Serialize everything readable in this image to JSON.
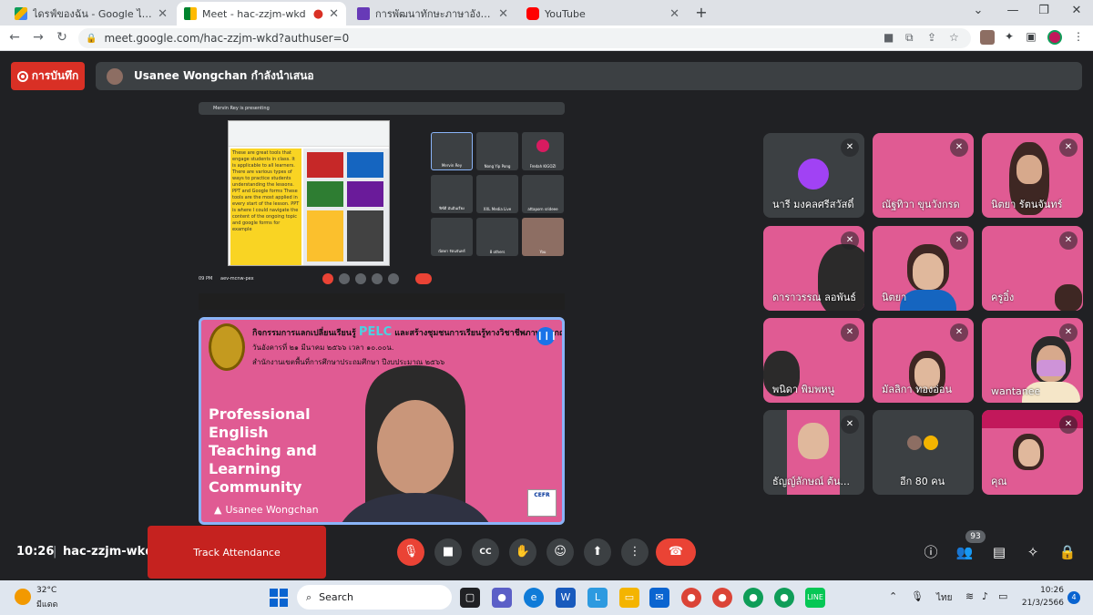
{
  "browser": {
    "tabs": [
      {
        "title": "ไดรฟ์ของฉัน - Google ไดรฟ์",
        "icon": "google-drive-icon",
        "active": false
      },
      {
        "title": "Meet - hac-zzjm-wkd",
        "icon": "google-meet-icon",
        "active": true
      },
      {
        "title": "การพัฒนาทักษะภาษาอังกฤษ English",
        "icon": "google-forms-icon",
        "active": false
      },
      {
        "title": "YouTube",
        "icon": "youtube-icon",
        "active": false
      }
    ],
    "url": "meet.google.com/hac-zzjm-wkd?authuser=0"
  },
  "meet": {
    "record_label": "การบันทึก",
    "presenting_text": "Usanee Wongchan กำลังนำเสนอ",
    "shared_screen": {
      "header": "Mervin Rey is presenting",
      "doc_text": "These are great tools that engage students in class. It is applicable to all learners. There are various types of ways to practice students understanding the lessons. PPT and Google forms These tools are the most applied in every start of the lesson. PPT is where I could navigate the content of the ongoing topic and google forms for example",
      "minis": [
        "Mervin Rey",
        "Nong Yip Pong",
        "Fredah KIGOZI",
        "ฟิซ์ดี มันอินเรียง",
        "XXL Media Live",
        "attaporn srideee",
        "ณิตยา รัตนจันทร์",
        "8 others",
        "You"
      ],
      "meeting_code": "aev-mcnw-pex",
      "time": "09 PM"
    },
    "speaker": {
      "slide_title_1": "กิจกรรมการแลกเปลี่ยนเรียนรู้",
      "slide_pelc": "PELC",
      "slide_title_1b": "และสร้างชุมชนการเรียนรู้ทางวิชาชีพภาษาอังกฤษ",
      "slide_title_2": "วันอังคารที่ ๒๑ มีนาคม ๒๕๖๖ เวลา ๑๐.๐๐น.",
      "slide_title_3": "สำนักงานเขตพื้นที่การศึกษาประถมศึกษา ปีงบประมาณ ๒๕๖๖",
      "big_text": "Professional English Teaching and Learning Community",
      "name": "Usanee Wongchan",
      "badge": "CEFR"
    },
    "grid": [
      {
        "name": "นารี มงคลศรีสวัสดิ์",
        "type": "avatar"
      },
      {
        "name": "ณัฐทิวา ขุนวังกรด",
        "type": "pink"
      },
      {
        "name": "นิตยา รัตนจันทร์",
        "type": "pink-face"
      },
      {
        "name": "ดาราวรรณ ลอพันธ์",
        "type": "pink"
      },
      {
        "name": "นิตยา",
        "type": "pink-face"
      },
      {
        "name": "ครูอิ๋ง",
        "type": "pink"
      },
      {
        "name": "พนิดา พิมพหนู",
        "type": "pink"
      },
      {
        "name": "มัลลิกา ทองอ่อน",
        "type": "pink-face"
      },
      {
        "name": "wantanee",
        "type": "pink-face"
      },
      {
        "name": "ธัญญ์ลักษณ์ ต้น...",
        "type": "pink-face"
      },
      {
        "name": "อีก 80 คน",
        "type": "others"
      },
      {
        "name": "คุณ",
        "type": "pink-face"
      }
    ],
    "bottom": {
      "time": "10:26",
      "separator": "|",
      "code": "hac-zzjm-wkd",
      "track_label": "Track Attendance",
      "people_count": "93"
    }
  },
  "taskbar": {
    "temp": "32°C",
    "weather": "มีแดด",
    "search": "Search",
    "lang": "ไทย",
    "time": "10:26",
    "date": "21/3/2566",
    "notif": "4"
  },
  "colors": {
    "meet_bg": "#202124",
    "slide_pink": "#e05b93",
    "record_red": "#d93025",
    "active_blue": "#8ab4f8"
  }
}
